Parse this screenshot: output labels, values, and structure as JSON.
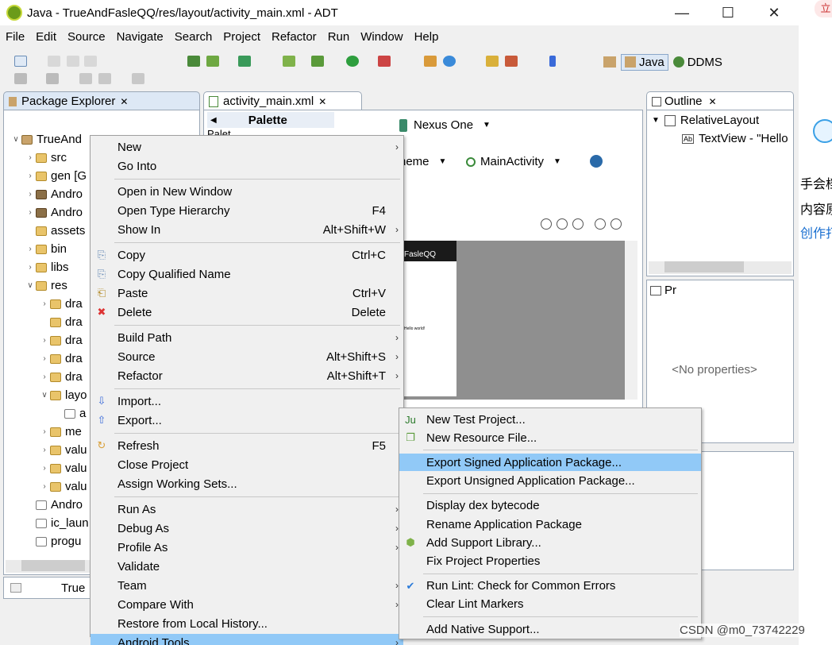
{
  "window": {
    "title": "Java - TrueAndFasleQQ/res/layout/activity_main.xml - ADT"
  },
  "menubar": [
    "File",
    "Edit",
    "Source",
    "Navigate",
    "Search",
    "Project",
    "Refactor",
    "Run",
    "Window",
    "Help"
  ],
  "perspectives": {
    "java": "Java",
    "ddms": "DDMS"
  },
  "package_explorer": {
    "title": "Package Explorer",
    "rows": [
      {
        "label": "TrueAnd"
      },
      {
        "label": "src"
      },
      {
        "label": "gen [G"
      },
      {
        "label": "Andro"
      },
      {
        "label": "Andro"
      },
      {
        "label": "assets"
      },
      {
        "label": "bin"
      },
      {
        "label": "libs"
      },
      {
        "label": "res"
      },
      {
        "label": "dra"
      },
      {
        "label": "dra"
      },
      {
        "label": "dra"
      },
      {
        "label": "dra"
      },
      {
        "label": "dra"
      },
      {
        "label": "layo"
      },
      {
        "label": "a"
      },
      {
        "label": "me"
      },
      {
        "label": "valu"
      },
      {
        "label": "valu"
      },
      {
        "label": "valu"
      },
      {
        "label": "Andro"
      },
      {
        "label": "ic_laun"
      },
      {
        "label": "progu"
      }
    ],
    "status": "True"
  },
  "editor": {
    "tab": "activity_main.xml",
    "palette": "Palette",
    "palette_item": "Palet",
    "device": "Nexus One",
    "theme": "neme",
    "activity": "MainActivity",
    "preview_title": "FasleQQ",
    "preview_text": "Hello world!"
  },
  "outline": {
    "title": "Outline",
    "root": "RelativeLayout",
    "child_badge": "Ab",
    "child": "TextView - \"Hello",
    "properties_tab": "Pr",
    "no_properties": "<No properties>"
  },
  "context_menu": [
    {
      "label": "New",
      "submenu": true
    },
    {
      "label": "Go Into"
    },
    {
      "sep": true
    },
    {
      "label": "Open in New Window"
    },
    {
      "label": "Open Type Hierarchy",
      "accel": "F4"
    },
    {
      "label": "Show In",
      "accel": "Alt+Shift+W",
      "submenu": true
    },
    {
      "sep": true
    },
    {
      "label": "Copy",
      "accel": "Ctrl+C",
      "icon": "copy-icon"
    },
    {
      "label": "Copy Qualified Name",
      "icon": "copy-icon"
    },
    {
      "label": "Paste",
      "accel": "Ctrl+V",
      "icon": "paste-icon"
    },
    {
      "label": "Delete",
      "accel": "Delete",
      "icon": "delete-icon"
    },
    {
      "sep": true
    },
    {
      "label": "Build Path",
      "submenu": true
    },
    {
      "label": "Source",
      "accel": "Alt+Shift+S",
      "submenu": true
    },
    {
      "label": "Refactor",
      "accel": "Alt+Shift+T",
      "submenu": true
    },
    {
      "sep": true
    },
    {
      "label": "Import...",
      "icon": "import-icon"
    },
    {
      "label": "Export...",
      "icon": "export-icon"
    },
    {
      "sep": true
    },
    {
      "label": "Refresh",
      "accel": "F5",
      "icon": "refresh-icon"
    },
    {
      "label": "Close Project"
    },
    {
      "label": "Assign Working Sets..."
    },
    {
      "sep": true
    },
    {
      "label": "Run As",
      "submenu": true
    },
    {
      "label": "Debug As",
      "submenu": true
    },
    {
      "label": "Profile As",
      "submenu": true
    },
    {
      "label": "Validate"
    },
    {
      "label": "Team",
      "submenu": true
    },
    {
      "label": "Compare With",
      "submenu": true
    },
    {
      "label": "Restore from Local History..."
    },
    {
      "label": "Android Tools",
      "submenu": true,
      "highlighted": true
    }
  ],
  "android_tools_menu": [
    {
      "label": "New Test Project...",
      "icon": "junit-icon"
    },
    {
      "label": "New Resource File...",
      "icon": "android-file-icon"
    },
    {
      "sep": true
    },
    {
      "label": "Export Signed Application Package...",
      "highlighted": true
    },
    {
      "label": "Export Unsigned Application Package..."
    },
    {
      "sep": true
    },
    {
      "label": "Display dex bytecode"
    },
    {
      "label": "Rename Application Package"
    },
    {
      "label": "Add Support Library...",
      "icon": "android-robot-icon"
    },
    {
      "label": "Fix Project Properties"
    },
    {
      "sep": true
    },
    {
      "label": "Run Lint: Check for Common Errors",
      "icon": "checkmark-icon"
    },
    {
      "label": "Clear Lint Markers"
    },
    {
      "sep": true
    },
    {
      "label": "Add Native Support..."
    }
  ],
  "right_strip": {
    "lines": [
      "手会档",
      "内容原",
      "创作打"
    ],
    "top_badge": "立"
  },
  "watermark": "CSDN @m0_73742229",
  "colors": {
    "highlight": "#91c9f7",
    "menu_bg": "#f0f0f0",
    "panel_border": "#9aa7b6"
  }
}
